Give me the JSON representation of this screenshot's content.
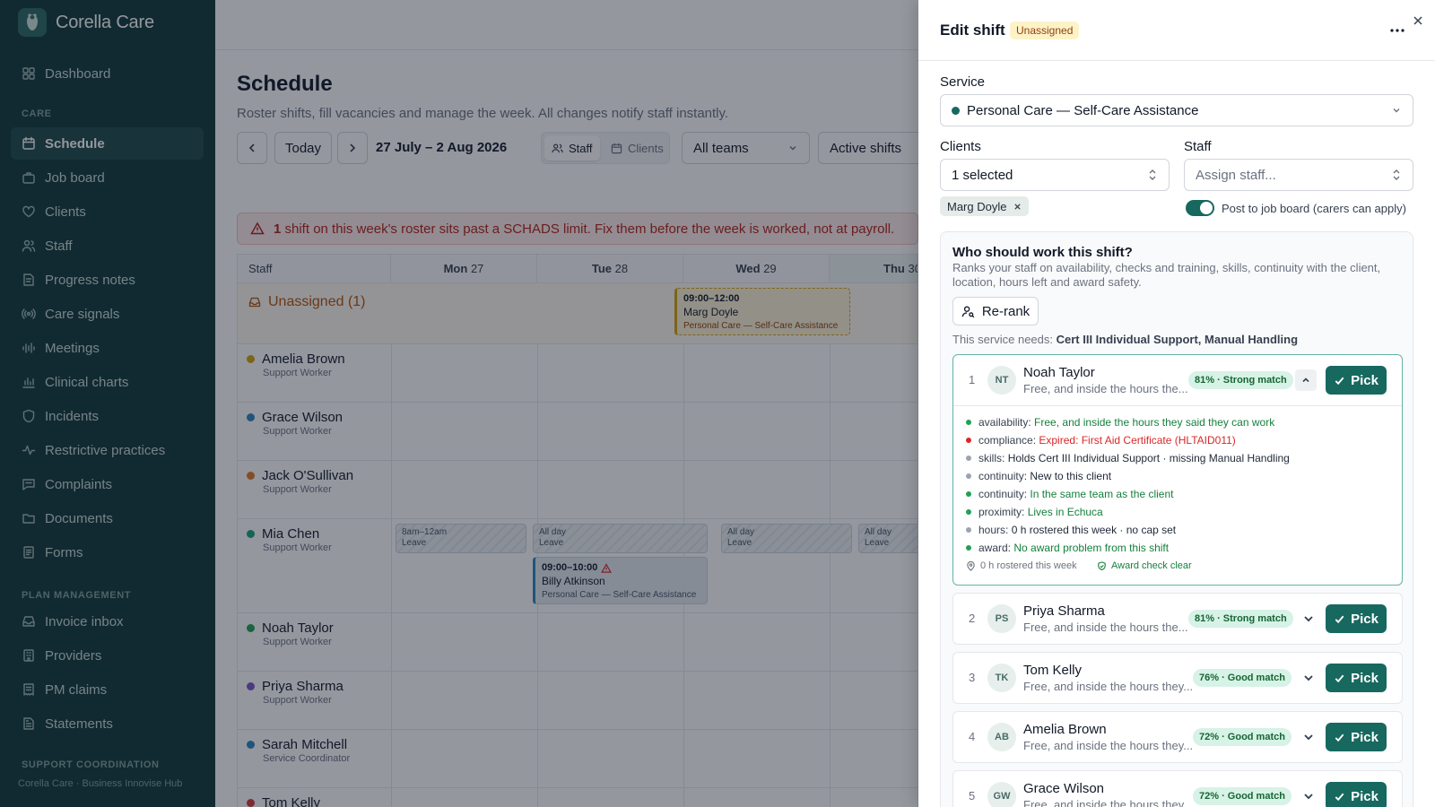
{
  "brand": {
    "name": "Corella Care"
  },
  "sidebar": {
    "dashboard": "Dashboard",
    "section_care": "CARE",
    "care_items": [
      {
        "label": "Schedule",
        "icon": "calendar-icon"
      },
      {
        "label": "Job board",
        "icon": "briefcase-icon"
      },
      {
        "label": "Clients",
        "icon": "heart-icon"
      },
      {
        "label": "Staff",
        "icon": "users-icon"
      },
      {
        "label": "Progress notes",
        "icon": "note-icon"
      },
      {
        "label": "Care signals",
        "icon": "signal-icon"
      },
      {
        "label": "Meetings",
        "icon": "meetings-icon"
      },
      {
        "label": "Clinical charts",
        "icon": "chart-icon"
      },
      {
        "label": "Incidents",
        "icon": "shield-icon"
      },
      {
        "label": "Restrictive practices",
        "icon": "activity-icon"
      },
      {
        "label": "Complaints",
        "icon": "message-icon"
      },
      {
        "label": "Documents",
        "icon": "folder-icon"
      },
      {
        "label": "Forms",
        "icon": "form-icon"
      }
    ],
    "section_plan": "PLAN MANAGEMENT",
    "plan_items": [
      {
        "label": "Invoice inbox",
        "icon": "inbox-icon"
      },
      {
        "label": "Providers",
        "icon": "building-icon"
      },
      {
        "label": "PM claims",
        "icon": "claims-icon"
      },
      {
        "label": "Statements",
        "icon": "statement-icon"
      }
    ],
    "section_support": "SUPPORT COORDINATION",
    "footer": "Corella Care · Business Innovise Hub"
  },
  "schedule": {
    "title": "Schedule",
    "subtitle": "Roster shifts, fill vacancies and manage the week. All changes notify staff instantly.",
    "today": "Today",
    "week": "27 July – 2 Aug 2026",
    "view_staff": "Staff",
    "view_clients": "Clients",
    "team_filter": "All teams",
    "status_filter": "Active shifts",
    "alert_count": "1",
    "alert_text": " shift on this week's roster sits past a SCHADS limit. Fix them before the week is worked, not at payroll.",
    "columns": [
      {
        "day": "Staff",
        "num": ""
      },
      {
        "day": "Mon",
        "num": "27"
      },
      {
        "day": "Tue",
        "num": "28"
      },
      {
        "day": "Wed",
        "num": "29"
      },
      {
        "day": "Thu",
        "num": "30"
      }
    ],
    "unassigned_label": "Unassigned (1)",
    "unassigned_shift": {
      "time": "09:00–12:00",
      "client": "Marg Doyle",
      "service": "Personal Care — Self-Care Assistance"
    },
    "staff": [
      {
        "name": "Amelia Brown",
        "role": "Support Worker",
        "color": "#d4a20b"
      },
      {
        "name": "Grace Wilson",
        "role": "Support Worker",
        "color": "#2e86c1"
      },
      {
        "name": "Jack O'Sullivan",
        "role": "Support Worker",
        "color": "#e07b24"
      },
      {
        "name": "Mia Chen",
        "role": "Support Worker",
        "color": "#1aa37a"
      },
      {
        "name": "Noah Taylor",
        "role": "Support Worker",
        "color": "#22a054"
      },
      {
        "name": "Priya Sharma",
        "role": "Support Worker",
        "color": "#7e57c2"
      },
      {
        "name": "Sarah Mitchell",
        "role": "Service Coordinator",
        "color": "#2e86c1"
      },
      {
        "name": "Tom Kelly",
        "role": "",
        "color": "#d63a3a"
      }
    ],
    "mia_leave": [
      {
        "time": "8am–12am",
        "label": "Leave"
      },
      {
        "time": "All day",
        "label": "Leave"
      },
      {
        "time": "All day",
        "label": "Leave"
      },
      {
        "time": "All day",
        "label": "Leave"
      }
    ],
    "mia_shift": {
      "time": "09:00–10:00",
      "client": "Billy Atkinson",
      "service": "Personal Care — Self-Care Assistance"
    }
  },
  "panel": {
    "title": "Edit shift",
    "status": "Unassigned",
    "service_label": "Service",
    "service_value": "Personal Care — Self-Care Assistance",
    "clients_label": "Clients",
    "clients_value": "1 selected",
    "client_chip": "Marg Doyle",
    "staff_label": "Staff",
    "staff_placeholder": "Assign staff...",
    "job_board_toggle": "Post to job board (carers can apply)",
    "rank_title": "Who should work this shift?",
    "rank_desc": "Ranks your staff on availability, checks and training, skills, continuity with the client, location, hours left and award safety.",
    "rerank": "Re-rank",
    "needs_prefix": "This service needs: ",
    "needs_value": "Cert III Individual Support, Manual Handling",
    "pick_label": "Pick",
    "candidates": [
      {
        "rank": "1",
        "initials": "NT",
        "name": "Noah Taylor",
        "sub": "Free, and inside the hours the...",
        "match": "81% · Strong match"
      },
      {
        "rank": "2",
        "initials": "PS",
        "name": "Priya Sharma",
        "sub": "Free, and inside the hours the...",
        "match": "81% · Strong match"
      },
      {
        "rank": "3",
        "initials": "TK",
        "name": "Tom Kelly",
        "sub": "Free, and inside the hours they...",
        "match": "76% · Good match"
      },
      {
        "rank": "4",
        "initials": "AB",
        "name": "Amelia Brown",
        "sub": "Free, and inside the hours they...",
        "match": "72% · Good match"
      },
      {
        "rank": "5",
        "initials": "GW",
        "name": "Grace Wilson",
        "sub": "Free, and inside the hours they...",
        "match": "72% · Good match"
      }
    ],
    "factors": [
      {
        "key": "availability:",
        "value": "Free, and inside the hours they said they can work",
        "tone": "g"
      },
      {
        "key": "compliance:",
        "value": "Expired: First Aid Certificate (HLTAID011)",
        "tone": "r"
      },
      {
        "key": "skills:",
        "value": "Holds Cert III Individual Support · missing Manual Handling",
        "tone": "n"
      },
      {
        "key": "continuity:",
        "value": "New to this client",
        "tone": "n"
      },
      {
        "key": "continuity:",
        "value": "In the same team as the client",
        "tone": "g"
      },
      {
        "key": "proximity:",
        "value": "Lives in Echuca",
        "tone": "g"
      },
      {
        "key": "hours:",
        "value": "0 h rostered this week · no cap set",
        "tone": "n"
      },
      {
        "key": "award:",
        "value": "No award problem from this shift",
        "tone": "g"
      }
    ],
    "foot_hours": "0 h rostered this week",
    "foot_award": "Award check clear"
  }
}
